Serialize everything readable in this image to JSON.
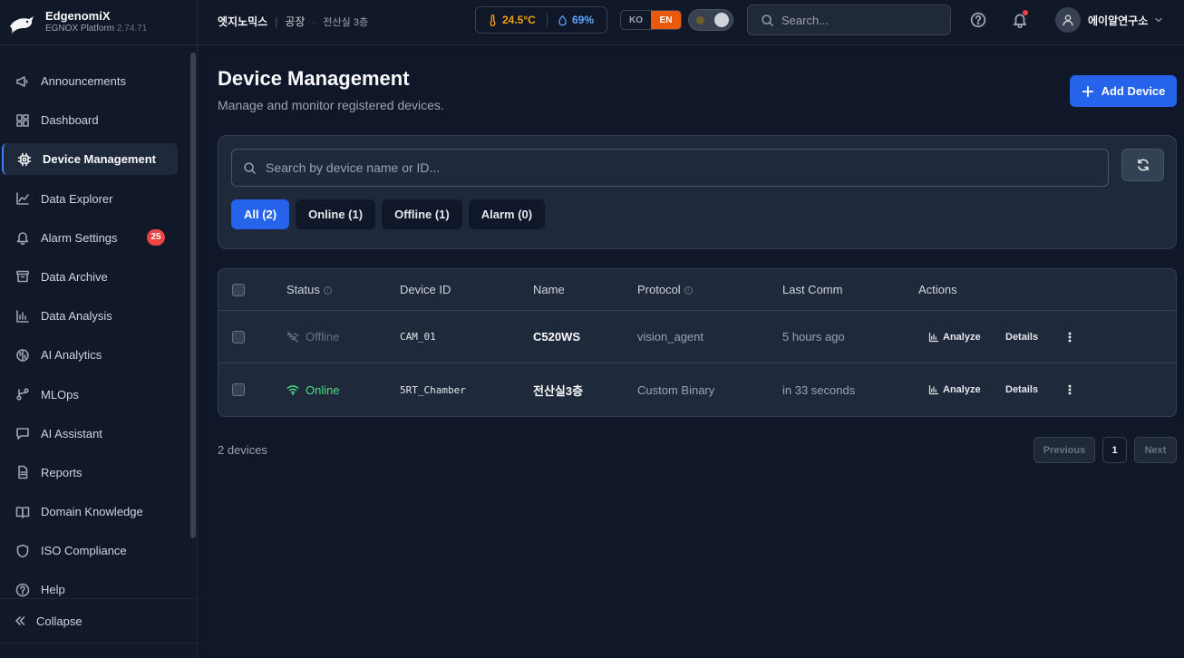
{
  "app": {
    "name": "EdgenomiX",
    "platform": "EGNOX Platform",
    "version": "2.74.71"
  },
  "sidebar": {
    "items": [
      {
        "label": "Announcements",
        "icon": "megaphone-icon"
      },
      {
        "label": "Dashboard",
        "icon": "dashboard-icon"
      },
      {
        "label": "Device Management",
        "icon": "chip-icon",
        "active": true
      },
      {
        "label": "Data Explorer",
        "icon": "chart-line-icon"
      },
      {
        "label": "Alarm Settings",
        "icon": "bell-icon",
        "badge": "25"
      },
      {
        "label": "Data Archive",
        "icon": "archive-icon"
      },
      {
        "label": "Data Analysis",
        "icon": "bar-chart-icon"
      },
      {
        "label": "AI Analytics",
        "icon": "brain-icon"
      },
      {
        "label": "MLOps",
        "icon": "branch-icon"
      },
      {
        "label": "AI Assistant",
        "icon": "chat-icon"
      },
      {
        "label": "Reports",
        "icon": "document-icon"
      },
      {
        "label": "Domain Knowledge",
        "icon": "book-icon"
      },
      {
        "label": "ISO Compliance",
        "icon": "shield-icon"
      },
      {
        "label": "Help",
        "icon": "help-icon"
      }
    ],
    "collapse_label": "Collapse"
  },
  "header": {
    "breadcrumb": [
      "엣지노믹스",
      "공장",
      "전산실 3층"
    ],
    "temperature": "24.5°C",
    "humidity": "69%",
    "lang_ko": "KO",
    "lang_en": "EN",
    "search_placeholder": "Search...",
    "user_name": "에이알연구소"
  },
  "main": {
    "title": "Device Management",
    "subtitle": "Manage and monitor registered devices.",
    "add_button": "Add Device",
    "search_placeholder": "Search by device name or ID...",
    "filters": [
      "All (2)",
      "Online (1)",
      "Offline (1)",
      "Alarm (0)"
    ],
    "table": {
      "columns": [
        "Status",
        "Device ID",
        "Name",
        "Protocol",
        "Last Comm",
        "Actions"
      ],
      "rows": [
        {
          "status": "Offline",
          "device_id": "CAM_01",
          "name": "C520WS",
          "protocol": "vision_agent",
          "last_comm": "5 hours ago",
          "analyze": "Analyze",
          "details": "Details"
        },
        {
          "status": "Online",
          "device_id": "5RT_Chamber",
          "name": "전산실3층",
          "protocol": "Custom Binary",
          "last_comm": "in 33 seconds",
          "analyze": "Analyze",
          "details": "Details"
        }
      ]
    },
    "count_label": "2 devices",
    "pagination": {
      "previous": "Previous",
      "page": "1",
      "next": "Next"
    }
  },
  "colors": {
    "accent": "#2563eb",
    "online": "#4ade80",
    "badge": "#ef4444",
    "lang_active": "#ea580c",
    "temperature": "#f59e0b",
    "humidity": "#60a5fa"
  }
}
